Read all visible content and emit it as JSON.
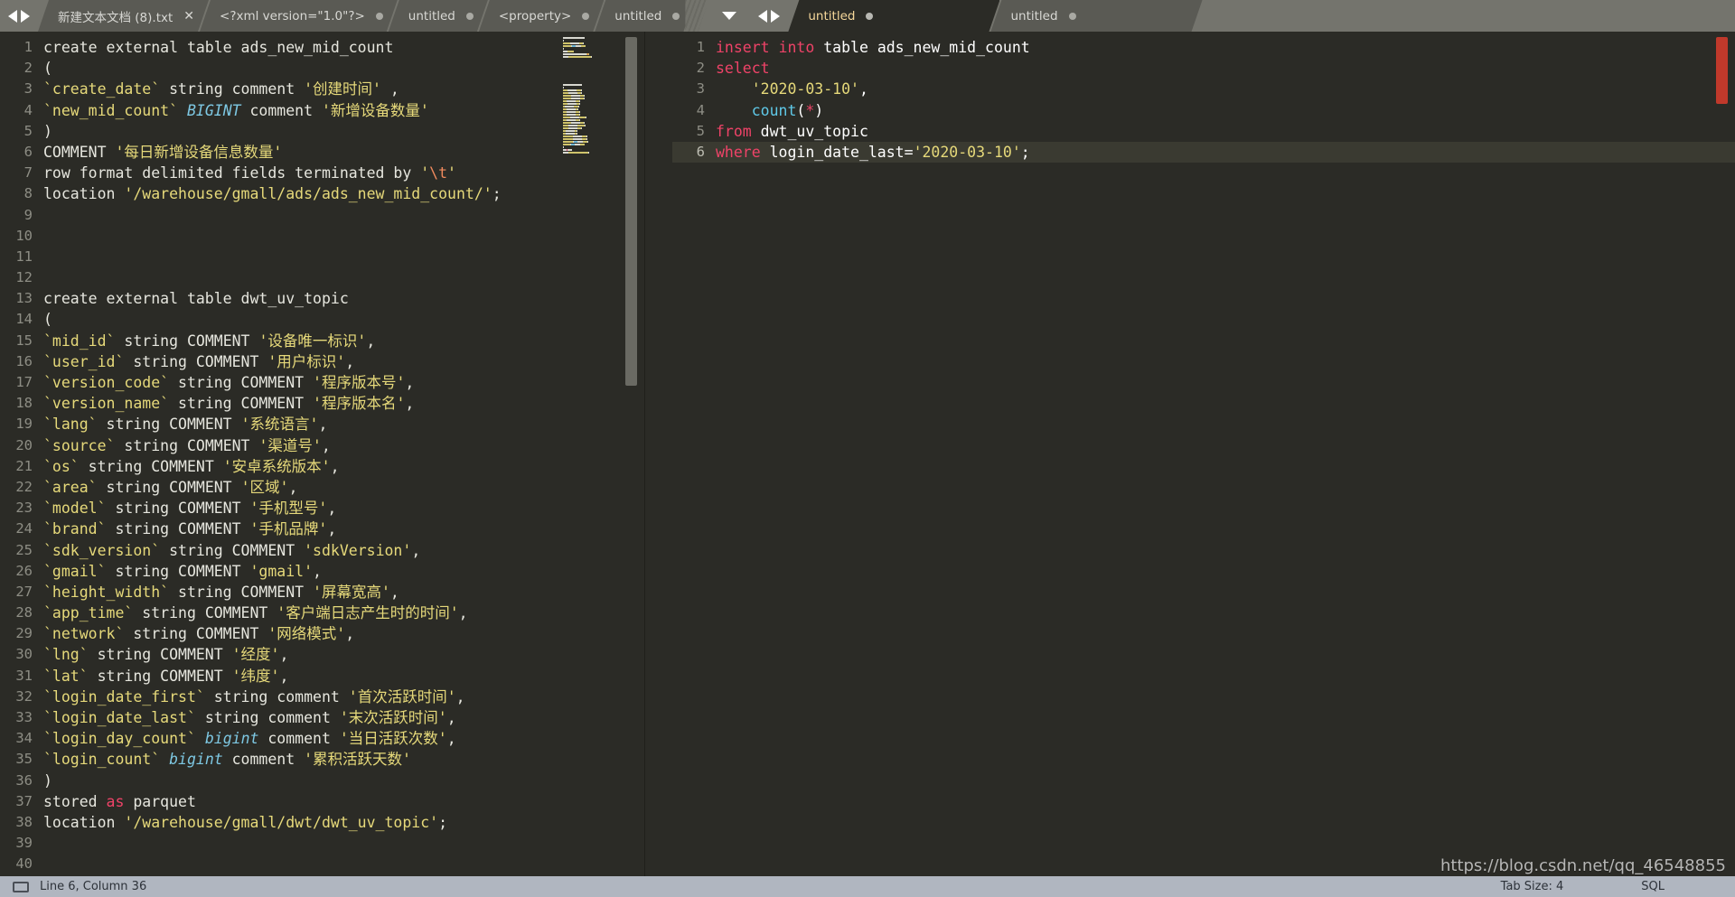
{
  "window": {
    "background_color": "#6e6e68",
    "editor_background": "#2b2b26"
  },
  "tabbar": {
    "nav_back_label": "◀",
    "nav_fwd_label": "▶",
    "left_group": [
      {
        "label": "新建文本文档 (8).txt",
        "indicator": "x",
        "active": false
      },
      {
        "label": "<?xml version=\"1.0\"?>",
        "indicator": "dot",
        "active": false
      },
      {
        "label": "untitled",
        "indicator": "dot",
        "active": false
      },
      {
        "label": "<property>",
        "indicator": "dot",
        "active": false
      },
      {
        "label": "untitled",
        "indicator": "dot",
        "active": false
      }
    ],
    "overflow_label": "▼",
    "right_group": [
      {
        "label": "untitled",
        "indicator": "dot",
        "active": true
      },
      {
        "label": "untitled",
        "indicator": "dot",
        "active": false
      }
    ]
  },
  "left_editor": {
    "language": "SQL",
    "lines": [
      {
        "n": 1,
        "tokens": [
          {
            "t": "create external table ads_new_mid_count",
            "c": "k"
          }
        ]
      },
      {
        "n": 2,
        "tokens": [
          {
            "t": "(",
            "c": "k"
          }
        ]
      },
      {
        "n": 3,
        "tokens": [
          {
            "t": "`create_date`",
            "c": "id"
          },
          {
            "t": " string comment ",
            "c": "k"
          },
          {
            "t": "'创建时间'",
            "c": "st"
          },
          {
            "t": " ,",
            "c": "k"
          }
        ]
      },
      {
        "n": 4,
        "tokens": [
          {
            "t": "`new_mid_count`",
            "c": "id"
          },
          {
            "t": " ",
            "c": "k"
          },
          {
            "t": "BIGINT",
            "c": "ty"
          },
          {
            "t": " comment ",
            "c": "k"
          },
          {
            "t": "'新增设备数量'",
            "c": "st"
          }
        ]
      },
      {
        "n": 5,
        "tokens": [
          {
            "t": ")",
            "c": "k"
          }
        ]
      },
      {
        "n": 6,
        "tokens": [
          {
            "t": "COMMENT ",
            "c": "k"
          },
          {
            "t": "'每日新增设备信息数量'",
            "c": "st"
          }
        ]
      },
      {
        "n": 7,
        "tokens": [
          {
            "t": "row format delimited fields terminated by ",
            "c": "k"
          },
          {
            "t": "'",
            "c": "st"
          },
          {
            "t": "\\t",
            "c": "esc"
          },
          {
            "t": "'",
            "c": "st"
          }
        ]
      },
      {
        "n": 8,
        "tokens": [
          {
            "t": "location ",
            "c": "k"
          },
          {
            "t": "'/warehouse/gmall/ads/ads_new_mid_count/'",
            "c": "st"
          },
          {
            "t": ";",
            "c": "k"
          }
        ]
      },
      {
        "n": 9,
        "tokens": []
      },
      {
        "n": 10,
        "tokens": []
      },
      {
        "n": 11,
        "tokens": []
      },
      {
        "n": 12,
        "tokens": []
      },
      {
        "n": 13,
        "tokens": [
          {
            "t": "create external table dwt_uv_topic",
            "c": "k"
          }
        ]
      },
      {
        "n": 14,
        "tokens": [
          {
            "t": "(",
            "c": "k"
          }
        ]
      },
      {
        "n": 15,
        "tokens": [
          {
            "t": "`mid_id`",
            "c": "id"
          },
          {
            "t": " string COMMENT ",
            "c": "k"
          },
          {
            "t": "'设备唯一标识'",
            "c": "st"
          },
          {
            "t": ",",
            "c": "k"
          }
        ]
      },
      {
        "n": 16,
        "tokens": [
          {
            "t": "`user_id`",
            "c": "id"
          },
          {
            "t": " string COMMENT ",
            "c": "k"
          },
          {
            "t": "'用户标识'",
            "c": "st"
          },
          {
            "t": ",",
            "c": "k"
          }
        ]
      },
      {
        "n": 17,
        "tokens": [
          {
            "t": "`version_code`",
            "c": "id"
          },
          {
            "t": " string COMMENT ",
            "c": "k"
          },
          {
            "t": "'程序版本号'",
            "c": "st"
          },
          {
            "t": ",",
            "c": "k"
          }
        ]
      },
      {
        "n": 18,
        "tokens": [
          {
            "t": "`version_name`",
            "c": "id"
          },
          {
            "t": " string COMMENT ",
            "c": "k"
          },
          {
            "t": "'程序版本名'",
            "c": "st"
          },
          {
            "t": ",",
            "c": "k"
          }
        ]
      },
      {
        "n": 19,
        "tokens": [
          {
            "t": "`lang`",
            "c": "id"
          },
          {
            "t": " string COMMENT ",
            "c": "k"
          },
          {
            "t": "'系统语言'",
            "c": "st"
          },
          {
            "t": ",",
            "c": "k"
          }
        ]
      },
      {
        "n": 20,
        "tokens": [
          {
            "t": "`source`",
            "c": "id"
          },
          {
            "t": " string COMMENT ",
            "c": "k"
          },
          {
            "t": "'渠道号'",
            "c": "st"
          },
          {
            "t": ",",
            "c": "k"
          }
        ]
      },
      {
        "n": 21,
        "tokens": [
          {
            "t": "`os`",
            "c": "id"
          },
          {
            "t": " string COMMENT ",
            "c": "k"
          },
          {
            "t": "'安卓系统版本'",
            "c": "st"
          },
          {
            "t": ",",
            "c": "k"
          }
        ]
      },
      {
        "n": 22,
        "tokens": [
          {
            "t": "`area`",
            "c": "id"
          },
          {
            "t": " string COMMENT ",
            "c": "k"
          },
          {
            "t": "'区域'",
            "c": "st"
          },
          {
            "t": ",",
            "c": "k"
          }
        ]
      },
      {
        "n": 23,
        "tokens": [
          {
            "t": "`model`",
            "c": "id"
          },
          {
            "t": " string COMMENT ",
            "c": "k"
          },
          {
            "t": "'手机型号'",
            "c": "st"
          },
          {
            "t": ",",
            "c": "k"
          }
        ]
      },
      {
        "n": 24,
        "tokens": [
          {
            "t": "`brand`",
            "c": "id"
          },
          {
            "t": " string COMMENT ",
            "c": "k"
          },
          {
            "t": "'手机品牌'",
            "c": "st"
          },
          {
            "t": ",",
            "c": "k"
          }
        ]
      },
      {
        "n": 25,
        "tokens": [
          {
            "t": "`sdk_version`",
            "c": "id"
          },
          {
            "t": " string COMMENT ",
            "c": "k"
          },
          {
            "t": "'sdkVersion'",
            "c": "st"
          },
          {
            "t": ",",
            "c": "k"
          }
        ]
      },
      {
        "n": 26,
        "tokens": [
          {
            "t": "`gmail`",
            "c": "id"
          },
          {
            "t": " string COMMENT ",
            "c": "k"
          },
          {
            "t": "'gmail'",
            "c": "st"
          },
          {
            "t": ",",
            "c": "k"
          }
        ]
      },
      {
        "n": 27,
        "tokens": [
          {
            "t": "`height_width`",
            "c": "id"
          },
          {
            "t": " string COMMENT ",
            "c": "k"
          },
          {
            "t": "'屏幕宽高'",
            "c": "st"
          },
          {
            "t": ",",
            "c": "k"
          }
        ]
      },
      {
        "n": 28,
        "tokens": [
          {
            "t": "`app_time`",
            "c": "id"
          },
          {
            "t": " string COMMENT ",
            "c": "k"
          },
          {
            "t": "'客户端日志产生时的时间'",
            "c": "st"
          },
          {
            "t": ",",
            "c": "k"
          }
        ]
      },
      {
        "n": 29,
        "tokens": [
          {
            "t": "`network`",
            "c": "id"
          },
          {
            "t": " string COMMENT ",
            "c": "k"
          },
          {
            "t": "'网络模式'",
            "c": "st"
          },
          {
            "t": ",",
            "c": "k"
          }
        ]
      },
      {
        "n": 30,
        "tokens": [
          {
            "t": "`lng`",
            "c": "id"
          },
          {
            "t": " string COMMENT ",
            "c": "k"
          },
          {
            "t": "'经度'",
            "c": "st"
          },
          {
            "t": ",",
            "c": "k"
          }
        ]
      },
      {
        "n": 31,
        "tokens": [
          {
            "t": "`lat`",
            "c": "id"
          },
          {
            "t": " string COMMENT ",
            "c": "k"
          },
          {
            "t": "'纬度'",
            "c": "st"
          },
          {
            "t": ",",
            "c": "k"
          }
        ]
      },
      {
        "n": 32,
        "tokens": [
          {
            "t": "`login_date_first`",
            "c": "id"
          },
          {
            "t": " string comment ",
            "c": "k"
          },
          {
            "t": "'首次活跃时间'",
            "c": "st"
          },
          {
            "t": ",",
            "c": "k"
          }
        ]
      },
      {
        "n": 33,
        "tokens": [
          {
            "t": "`login_date_last`",
            "c": "id"
          },
          {
            "t": " string comment ",
            "c": "k"
          },
          {
            "t": "'末次活跃时间'",
            "c": "st"
          },
          {
            "t": ",",
            "c": "k"
          }
        ]
      },
      {
        "n": 34,
        "tokens": [
          {
            "t": "`login_day_count`",
            "c": "id"
          },
          {
            "t": " ",
            "c": "k"
          },
          {
            "t": "bigint",
            "c": "ty"
          },
          {
            "t": " comment ",
            "c": "k"
          },
          {
            "t": "'当日活跃次数'",
            "c": "st"
          },
          {
            "t": ",",
            "c": "k"
          }
        ]
      },
      {
        "n": 35,
        "tokens": [
          {
            "t": "`login_count`",
            "c": "id"
          },
          {
            "t": " ",
            "c": "k"
          },
          {
            "t": "bigint",
            "c": "ty"
          },
          {
            "t": " comment ",
            "c": "k"
          },
          {
            "t": "'累积活跃天数'",
            "c": "st"
          }
        ]
      },
      {
        "n": 36,
        "tokens": [
          {
            "t": ")",
            "c": "k"
          }
        ]
      },
      {
        "n": 37,
        "tokens": [
          {
            "t": "stored ",
            "c": "k"
          },
          {
            "t": "as",
            "c": "pk"
          },
          {
            "t": " parquet",
            "c": "k"
          }
        ]
      },
      {
        "n": 38,
        "tokens": [
          {
            "t": "location ",
            "c": "k"
          },
          {
            "t": "'/warehouse/gmall/dwt/dwt_uv_topic'",
            "c": "st"
          },
          {
            "t": ";",
            "c": "k"
          }
        ]
      },
      {
        "n": 39,
        "tokens": []
      },
      {
        "n": 40,
        "tokens": []
      }
    ]
  },
  "right_editor": {
    "lines": [
      {
        "n": 1,
        "current": false,
        "tokens": [
          {
            "t": "insert into",
            "c": "pk"
          },
          {
            "t": " table ads_new_mid_count",
            "c": "w"
          }
        ]
      },
      {
        "n": 2,
        "current": false,
        "tokens": [
          {
            "t": "select",
            "c": "pk"
          }
        ]
      },
      {
        "n": 3,
        "current": false,
        "tokens": [
          {
            "t": "    ",
            "c": "w"
          },
          {
            "t": "'2020-03-10'",
            "c": "st"
          },
          {
            "t": ",",
            "c": "w"
          }
        ]
      },
      {
        "n": 4,
        "current": false,
        "tokens": [
          {
            "t": "    ",
            "c": "w"
          },
          {
            "t": "count",
            "c": "fn"
          },
          {
            "t": "(",
            "c": "w"
          },
          {
            "t": "*",
            "c": "pn"
          },
          {
            "t": ")",
            "c": "w"
          }
        ]
      },
      {
        "n": 5,
        "current": false,
        "tokens": [
          {
            "t": "from",
            "c": "pk"
          },
          {
            "t": " dwt_uv_topic",
            "c": "w"
          }
        ]
      },
      {
        "n": 6,
        "current": true,
        "tokens": [
          {
            "t": "where",
            "c": "pk"
          },
          {
            "t": " login_date_last=",
            "c": "w"
          },
          {
            "t": "'2020-03-10'",
            "c": "st"
          },
          {
            "t": ";",
            "c": "w"
          }
        ]
      }
    ]
  },
  "statusbar": {
    "caret": "Line 6, Column 36",
    "tab_size": "Tab Size: 4",
    "language": "SQL"
  },
  "watermark": "https://blog.csdn.net/qq_46548855"
}
